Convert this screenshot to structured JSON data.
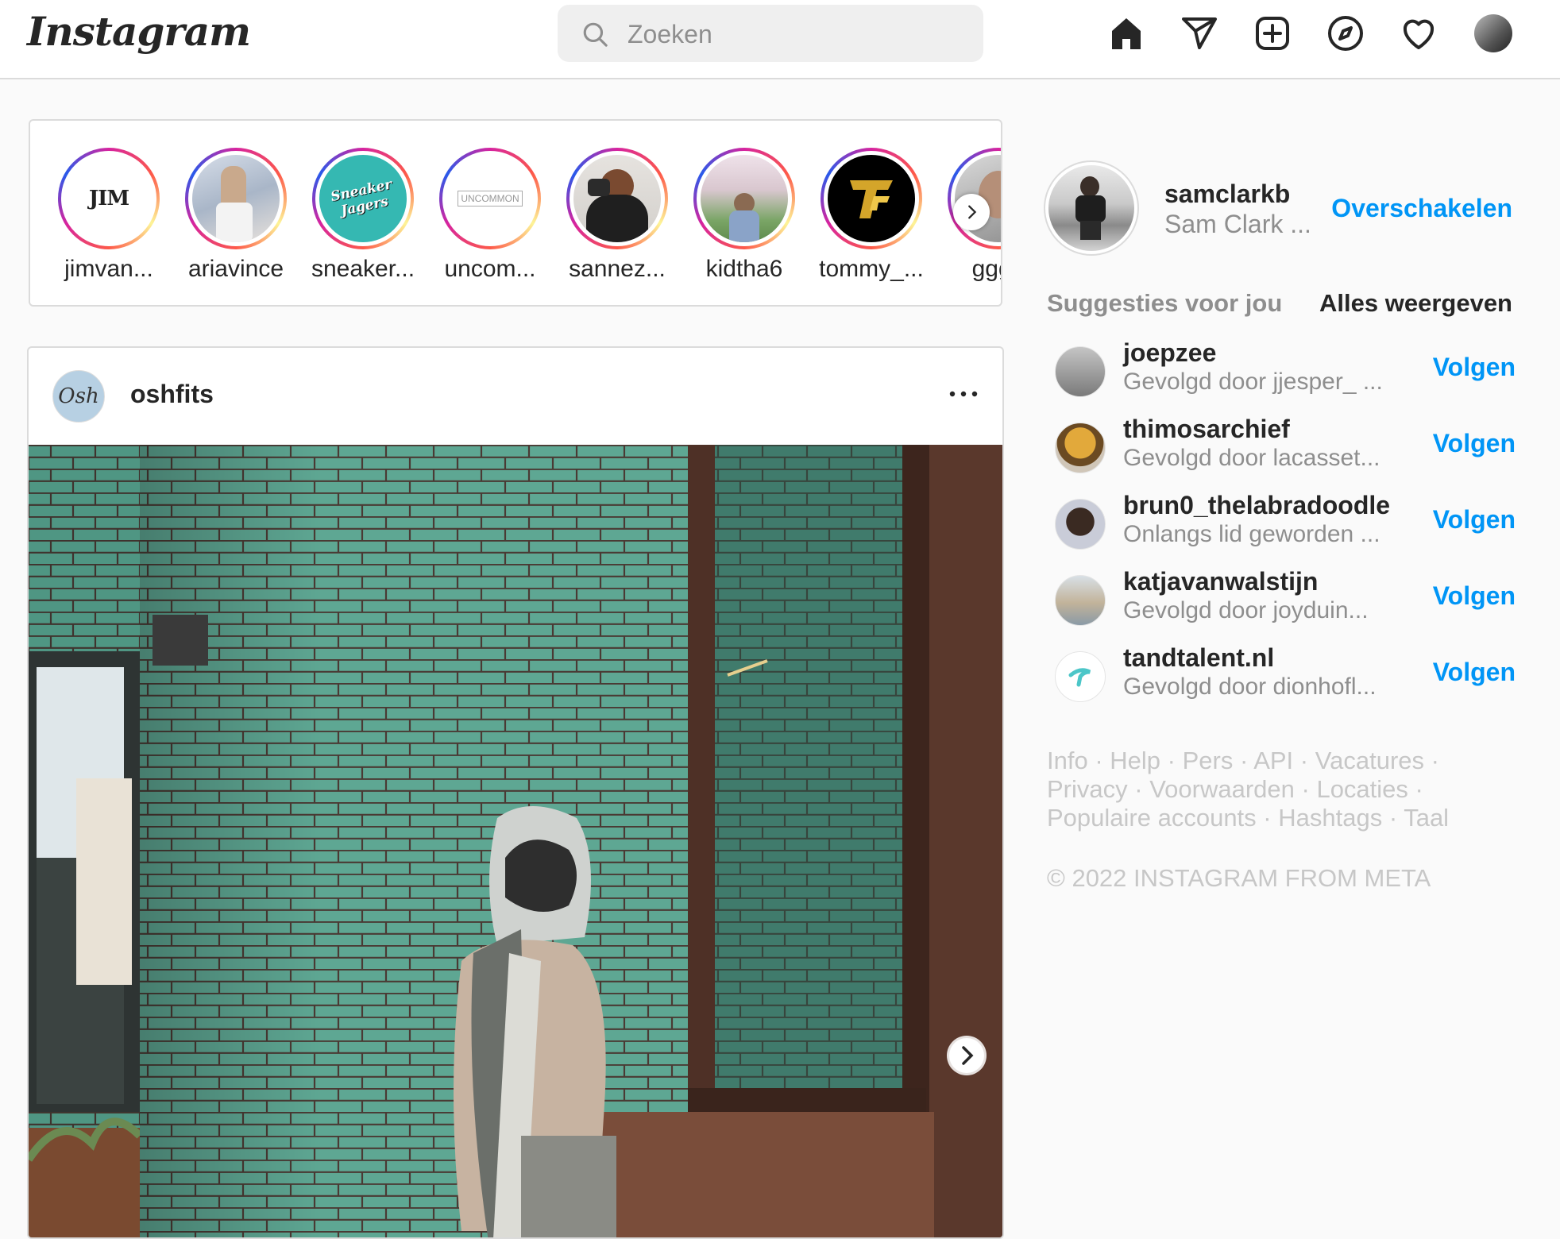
{
  "app": {
    "logo_text": "Instagram"
  },
  "search": {
    "placeholder": "Zoeken",
    "value": ""
  },
  "nav": {
    "icons": [
      "home-icon",
      "direct-icon",
      "new-post-icon",
      "explore-icon",
      "activity-icon",
      "profile-avatar"
    ]
  },
  "stories": [
    {
      "name": "jimvan..."
    },
    {
      "name": "ariavince"
    },
    {
      "name": "sneaker..."
    },
    {
      "name": "uncom..."
    },
    {
      "name": "sannez..."
    },
    {
      "name": "kidtha6"
    },
    {
      "name": "tommy_..."
    },
    {
      "name": "gggg"
    }
  ],
  "story_logos": {
    "jim": "JIM",
    "sneaker": "Sneaker Jagers",
    "uncommon": "UNCOMMON"
  },
  "post": {
    "username": "oshfits",
    "avatar_text": "Osh"
  },
  "profile": {
    "username": "samclarkb",
    "full_name": "Sam Clark ...",
    "switch_label": "Overschakelen"
  },
  "suggestions": {
    "title": "Suggesties voor jou",
    "see_all": "Alles weergeven",
    "items": [
      {
        "username": "joepzee",
        "subtitle": "Gevolgd door jjesper_ ...",
        "action": "Volgen"
      },
      {
        "username": "thimosarchief",
        "subtitle": "Gevolgd door lacasset...",
        "action": "Volgen"
      },
      {
        "username": "brun0_thelabradoodle",
        "subtitle": "Onlangs lid geworden ...",
        "action": "Volgen"
      },
      {
        "username": "katjavanwalstijn",
        "subtitle": "Gevolgd door joyduin...",
        "action": "Volgen"
      },
      {
        "username": "tandtalent.nl",
        "subtitle": "Gevolgd door dionhofl...",
        "action": "Volgen"
      }
    ]
  },
  "footer": {
    "links": [
      "Info",
      "Help",
      "Pers",
      "API",
      "Vacatures",
      "Privacy",
      "Voorwaarden",
      "Locaties",
      "Populaire accounts",
      "Hashtags",
      "Taal"
    ],
    "copyright": "© 2022 INSTAGRAM FROM META"
  },
  "colors": {
    "link_blue": "#0095f6",
    "muted": "#8e8e8e",
    "border": "#dbdbdb",
    "bg": "#fafafa"
  }
}
